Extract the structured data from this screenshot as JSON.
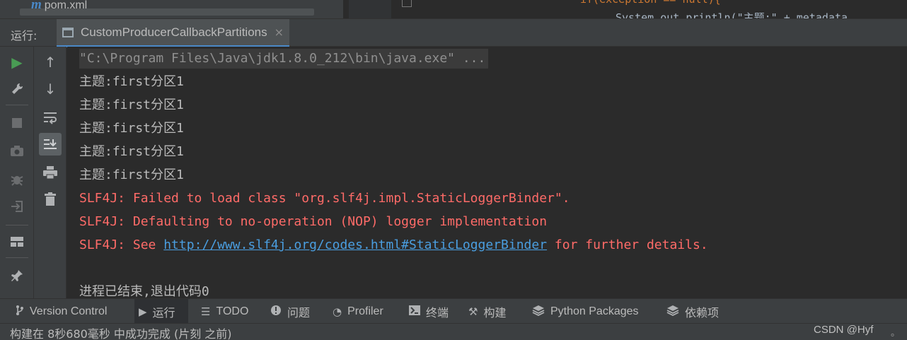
{
  "top": {
    "file_tab": "pom.xml",
    "file_icon": "m",
    "code_line_1": "if(exception == null){",
    "code_line_2": "System.out.println(\"主题:\" + metadata"
  },
  "run_panel": {
    "label": "运行:",
    "tab_title": "CustomProducerCallbackPartitions",
    "tab_close": "×"
  },
  "toolbar_outer": [
    {
      "name": "rerun-icon",
      "glyph": "▶",
      "color": "#499c54"
    },
    {
      "name": "wrench-icon",
      "glyph": "🔧"
    },
    {
      "name": "stop-icon",
      "glyph": "■"
    },
    {
      "name": "camera-icon",
      "glyph": "📷"
    },
    {
      "name": "debug-icon",
      "glyph": "✱"
    },
    {
      "name": "exit-icon",
      "glyph": "⇥"
    },
    {
      "name": "layout-icon",
      "glyph": "▦"
    },
    {
      "name": "pin-icon",
      "glyph": "📌"
    }
  ],
  "toolbar_inner": [
    {
      "name": "up-arrow-icon",
      "glyph": "↑"
    },
    {
      "name": "down-arrow-icon",
      "glyph": "↓"
    },
    {
      "name": "soft-wrap-icon",
      "glyph": "⤶"
    },
    {
      "name": "scroll-to-end-icon",
      "glyph": "⇊"
    },
    {
      "name": "print-icon",
      "glyph": "⎙"
    },
    {
      "name": "trash-icon",
      "glyph": "🗑"
    }
  ],
  "console": {
    "command": "\"C:\\Program Files\\Java\\jdk1.8.0_212\\bin\\java.exe\" ...",
    "outputs": [
      "主题:first分区1",
      "主题:first分区1",
      "主题:first分区1",
      "主题:first分区1",
      "主题:first分区1"
    ],
    "errors": [
      "SLF4J: Failed to load class \"org.slf4j.impl.StaticLoggerBinder\".",
      "SLF4J: Defaulting to no-operation (NOP) logger implementation"
    ],
    "see_prefix": "SLF4J: See ",
    "see_link": "http://www.slf4j.org/codes.html#StaticLoggerBinder",
    "see_suffix": " for further details.",
    "exit_line": "进程已结束,退出代码0"
  },
  "tool_windows": [
    {
      "name": "version-control",
      "icon": "ᚹ",
      "label": "Version Control"
    },
    {
      "name": "run",
      "icon": "▶",
      "label": "运行"
    },
    {
      "name": "todo",
      "icon": "☰",
      "label": "TODO"
    },
    {
      "name": "problems",
      "icon": "❶",
      "label": "问题"
    },
    {
      "name": "profiler",
      "icon": "◔",
      "label": "Profiler"
    },
    {
      "name": "terminal",
      "icon": "▣",
      "label": "终端"
    },
    {
      "name": "build",
      "icon": "⚒",
      "label": "构建"
    },
    {
      "name": "python-packages",
      "icon": "◈",
      "label": "Python Packages"
    },
    {
      "name": "dependencies",
      "icon": "◈",
      "label": "依赖项"
    }
  ],
  "status": {
    "message": "构建在 8秒680毫秒 中成功完成 (片刻 之前)",
    "watermark": "CSDN @Hyf",
    "dot": "。"
  },
  "colors": {
    "background": "#2b2b2b",
    "panel": "#3c3f41",
    "error_text": "#ff6b68",
    "link": "#4a9ee0",
    "accent": "#4a88c7"
  }
}
